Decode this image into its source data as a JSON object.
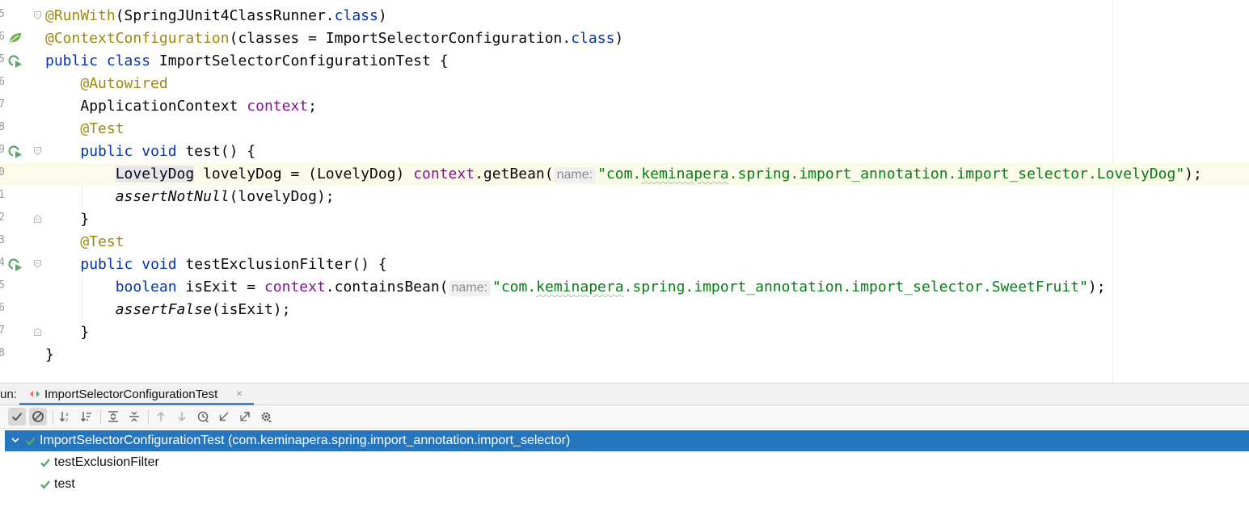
{
  "editor": {
    "line_numbers": [
      "5",
      "6",
      "5",
      "6",
      "7",
      "8",
      "9",
      "0",
      "1",
      "2",
      "3",
      "4",
      "5",
      "6",
      "7",
      "8"
    ],
    "tokens": {
      "run_with": "@RunWith",
      "runner_arg": "(SpringJUnit4ClassRunner.",
      "class_kw": "class",
      "close_paren": ")",
      "context_configuration": "@ContextConfiguration",
      "classes_arg": "(classes = ImportSelectorConfiguration.",
      "public_kw": "public",
      "class_decl": "ImportSelectorConfigurationTest {",
      "autowired": "@Autowired",
      "app_context_type": "ApplicationContext",
      "context_field": "context",
      "semicolon": ";",
      "test_annotation": "@Test",
      "void_kw": "void",
      "test_method": "test() {",
      "lovelydog_type": "LovelyDog",
      "lovelydog_decl": " lovelyDog = (",
      "lovelydog_cast": "LovelyDog",
      "cast_close": ") ",
      "get_bean": ".getBean(",
      "name_hint": "name:",
      "lovelydog_string_start": "\"com.",
      "keminapera": "keminapera",
      "lovelydog_string_end": ".spring.import_annotation.import_selector.LovelyDog\"",
      "stmt_end": ");",
      "assert_not_null": "assertNotNull",
      "assert_not_null_arg": "(lovelyDog);",
      "close_brace": "}",
      "exclusion_method": "testExclusionFilter() {",
      "boolean_kw": "boolean",
      "isexit_decl": " isExit = ",
      "contains_bean": ".containsBean(",
      "sweetfruit_string_end": ".spring.import_annotation.import_selector.SweetFruit\"",
      "assert_false": "assertFalse",
      "assert_false_arg": "(isExit);"
    }
  },
  "run_panel": {
    "run_label": "un:",
    "tab_title": "ImportSelectorConfigurationTest",
    "tab_close": "×",
    "toolbar": [
      "show-passed",
      "show-ignored",
      "sort-alphabetically",
      "sort-by-duration",
      "expand-all",
      "collapse-all",
      "previous-failed-test",
      "next-failed-test",
      "test-history",
      "import-tests",
      "export-tests",
      "settings"
    ],
    "tree": {
      "root": "ImportSelectorConfigurationTest (com.keminapera.spring.import_annotation.import_selector)",
      "children": [
        "testExclusionFilter",
        "test"
      ]
    },
    "colors": {
      "selection": "#2675bf",
      "pass_check": "#59a869",
      "tab_underline": "#4083c9"
    }
  }
}
